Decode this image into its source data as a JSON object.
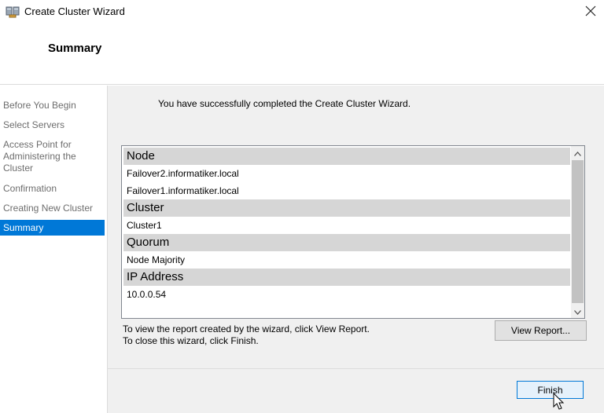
{
  "window": {
    "title": "Create Cluster Wizard",
    "icon": "cluster-wizard-icon"
  },
  "header": {
    "title": "Summary"
  },
  "nav": {
    "items": [
      {
        "label": "Before You Begin"
      },
      {
        "label": "Select Servers"
      },
      {
        "label": "Access Point for Administering the Cluster"
      },
      {
        "label": "Confirmation"
      },
      {
        "label": "Creating New Cluster"
      },
      {
        "label": "Summary",
        "selected": true
      }
    ]
  },
  "main": {
    "message": "You have successfully completed the Create Cluster Wizard.",
    "report": {
      "sections": [
        {
          "title": "Node",
          "rows": [
            "Failover2.informatiker.local",
            "Failover1.informatiker.local"
          ]
        },
        {
          "title": "Cluster",
          "rows": [
            "Cluster1"
          ]
        },
        {
          "title": "Quorum",
          "rows": [
            "Node Majority"
          ]
        },
        {
          "title": "IP Address",
          "rows": [
            "10.0.0.54"
          ]
        }
      ]
    },
    "info_line1": "To view the report created by the wizard, click View Report.",
    "info_line2": "To close this wizard, click Finish.",
    "view_report_label": "View Report..."
  },
  "footer": {
    "finish_label": "Finish"
  },
  "colors": {
    "accent": "#0078d7",
    "section_header": "#d6d6d6",
    "panel": "#f0f0f0"
  }
}
